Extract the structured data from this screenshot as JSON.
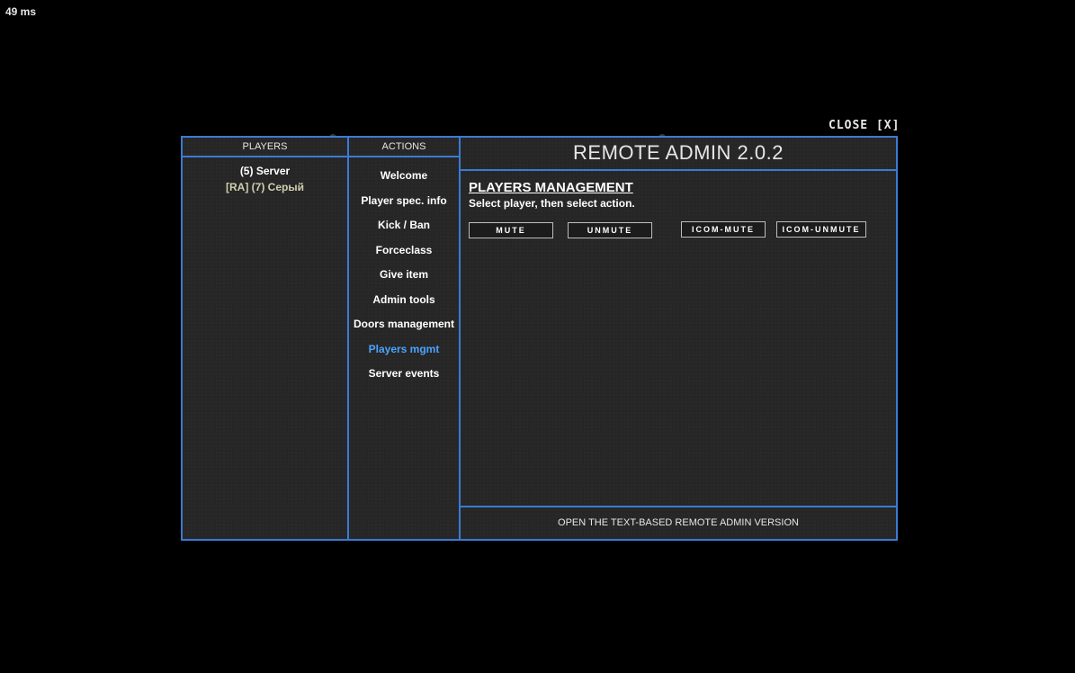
{
  "ping": "49 ms",
  "close_label": "CLOSE [X]",
  "players_panel": {
    "header": "PLAYERS",
    "items": [
      {
        "label": "(5) Server"
      },
      {
        "label": "[RA] (7) Серый"
      }
    ]
  },
  "actions_panel": {
    "header": "ACTIONS",
    "items": [
      {
        "label": "Welcome"
      },
      {
        "label": "Player spec. info"
      },
      {
        "label": "Kick / Ban"
      },
      {
        "label": "Forceclass"
      },
      {
        "label": "Give item"
      },
      {
        "label": "Admin tools"
      },
      {
        "label": "Doors management"
      },
      {
        "label": "Players mgmt"
      },
      {
        "label": "Server events"
      }
    ],
    "active_index": 7
  },
  "main": {
    "title": "REMOTE ADMIN 2.0.2",
    "section_title": "PLAYERS MANAGEMENT",
    "section_subtitle": "Select player, then select action.",
    "buttons": {
      "mute": "MUTE",
      "unmute": "UNMUTE",
      "icom_mute": "ICOM-MUTE",
      "icom_unmute": "ICOM-UNMUTE"
    },
    "footer": "OPEN THE TEXT-BASED REMOTE ADMIN VERSION"
  },
  "colors": {
    "accent_border": "#3a7bd5",
    "active_item": "#4aa3ff",
    "panel_bg": "#262626"
  }
}
